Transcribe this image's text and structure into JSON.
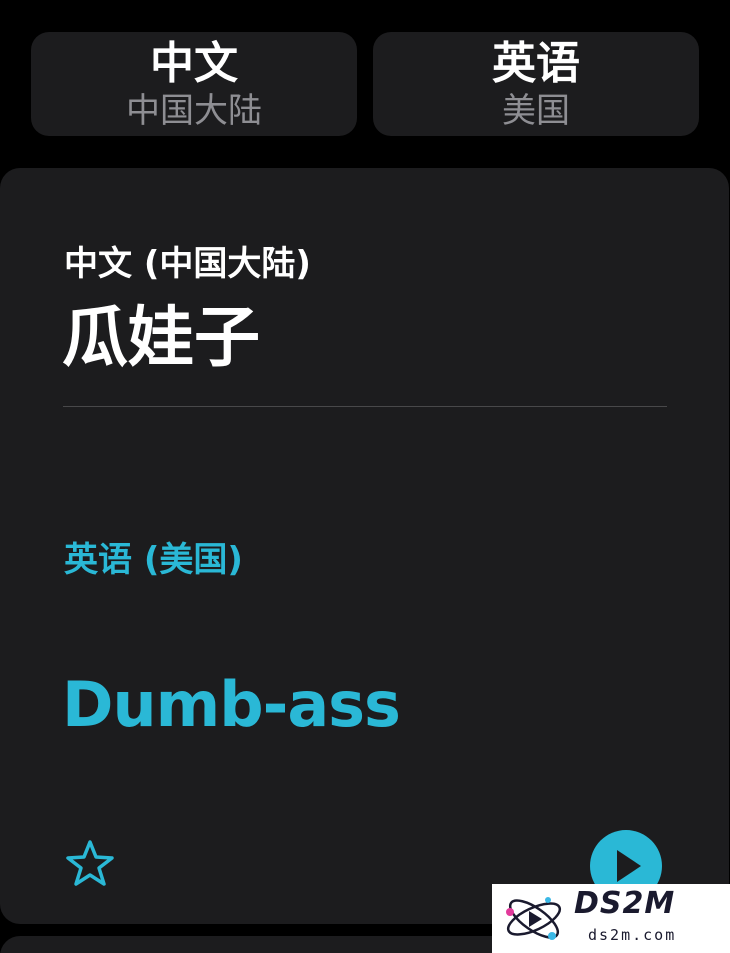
{
  "language_bar": {
    "source": {
      "name": "中文",
      "region": "中国大陆"
    },
    "target": {
      "name": "英语",
      "region": "美国"
    }
  },
  "translation_card": {
    "source_label": "中文 (中国大陆)",
    "source_text": "瓜娃子",
    "target_label": "英语 (美国)",
    "target_text": "Dumb-ass",
    "favorite_icon": "star-outline-icon",
    "play_icon": "play-icon"
  },
  "watermark": {
    "brand": "DS2M",
    "domain": "ds2m.com"
  },
  "colors": {
    "background": "#000000",
    "card": "#1c1c1e",
    "accent": "#2ab8d6",
    "secondary_text": "#8e8e93"
  }
}
